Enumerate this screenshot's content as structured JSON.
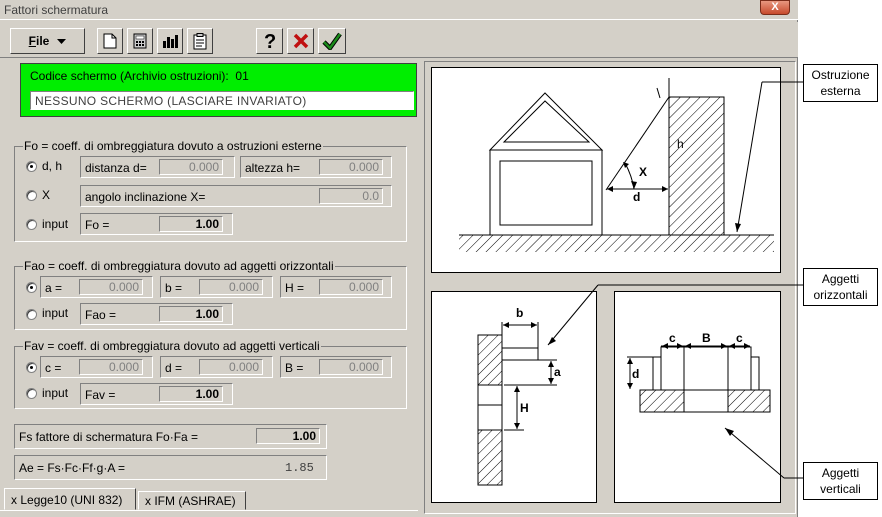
{
  "window": {
    "title": "Fattori schermatura",
    "close_label": "X"
  },
  "toolbar": {
    "file_label": "File",
    "file_mnemonic": "F",
    "file_rest": "ile"
  },
  "codice": {
    "label": "Codice schermo (Archivio ostruzioni):",
    "number": "01",
    "value": "NESSUNO SCHERMO (LASCIARE INVARIATO)"
  },
  "fo": {
    "legend": "Fo = coeff. di ombreggiatura dovuto a ostruzioni esterne",
    "opt_dh": "d, h",
    "opt_x": "X",
    "opt_input": "input",
    "distanza_label": "distanza d=",
    "distanza_value": "0.000",
    "altezza_label": "altezza h=",
    "altezza_value": "0.000",
    "angolo_label": "angolo inclinazione X=",
    "angolo_value": "0.0",
    "fo_label": "Fo =",
    "fo_value": "1.00"
  },
  "fao": {
    "legend": "Fao = coeff. di ombreggiatura dovuto ad aggetti orizzontali",
    "a_label": "a =",
    "a_value": "0.000",
    "b_label": "b =",
    "b_value": "0.000",
    "H_label": "H =",
    "H_value": "0.000",
    "opt_input": "input",
    "fao_label": "Fao =",
    "fao_value": "1.00"
  },
  "fav": {
    "legend": "Fav = coeff. di ombreggiatura dovuto ad aggetti verticali",
    "c_label": "c =",
    "c_value": "0.000",
    "d_label": "d =",
    "d_value": "0.000",
    "B_label": "B =",
    "B_value": "0.000",
    "opt_input": "input",
    "fav_label": "Fav =",
    "fav_value": "1.00"
  },
  "fs": {
    "label": "Fs  fattore di schermatura   Fo·Fa =",
    "value": "1.00"
  },
  "ae": {
    "label": "Ae = Fs·Fc·Ff·g·A =",
    "value": "1.85"
  },
  "tabs": [
    {
      "label": "Legge10 (UNI 832)",
      "prefix": "x"
    },
    {
      "label": "IFM (ASHRAE)",
      "prefix": "x"
    }
  ],
  "diagram": {
    "top_labels": {
      "h": "h",
      "X": "X",
      "d": "d"
    },
    "left_labels": {
      "b": "b",
      "a": "a",
      "H": "H"
    },
    "right_labels": {
      "c1": "c",
      "B": "B",
      "c2": "c",
      "d": "d"
    }
  },
  "callouts": {
    "ostruzione": "Ostruzione esterna",
    "aggetti_orizzontali": "Aggetti orizzontali",
    "aggetti_verticali": "Aggetti verticali"
  },
  "colors": {
    "codice_bg": "#00ee00",
    "face": "#d4d0c8",
    "close_btn": "#c74a2c"
  }
}
